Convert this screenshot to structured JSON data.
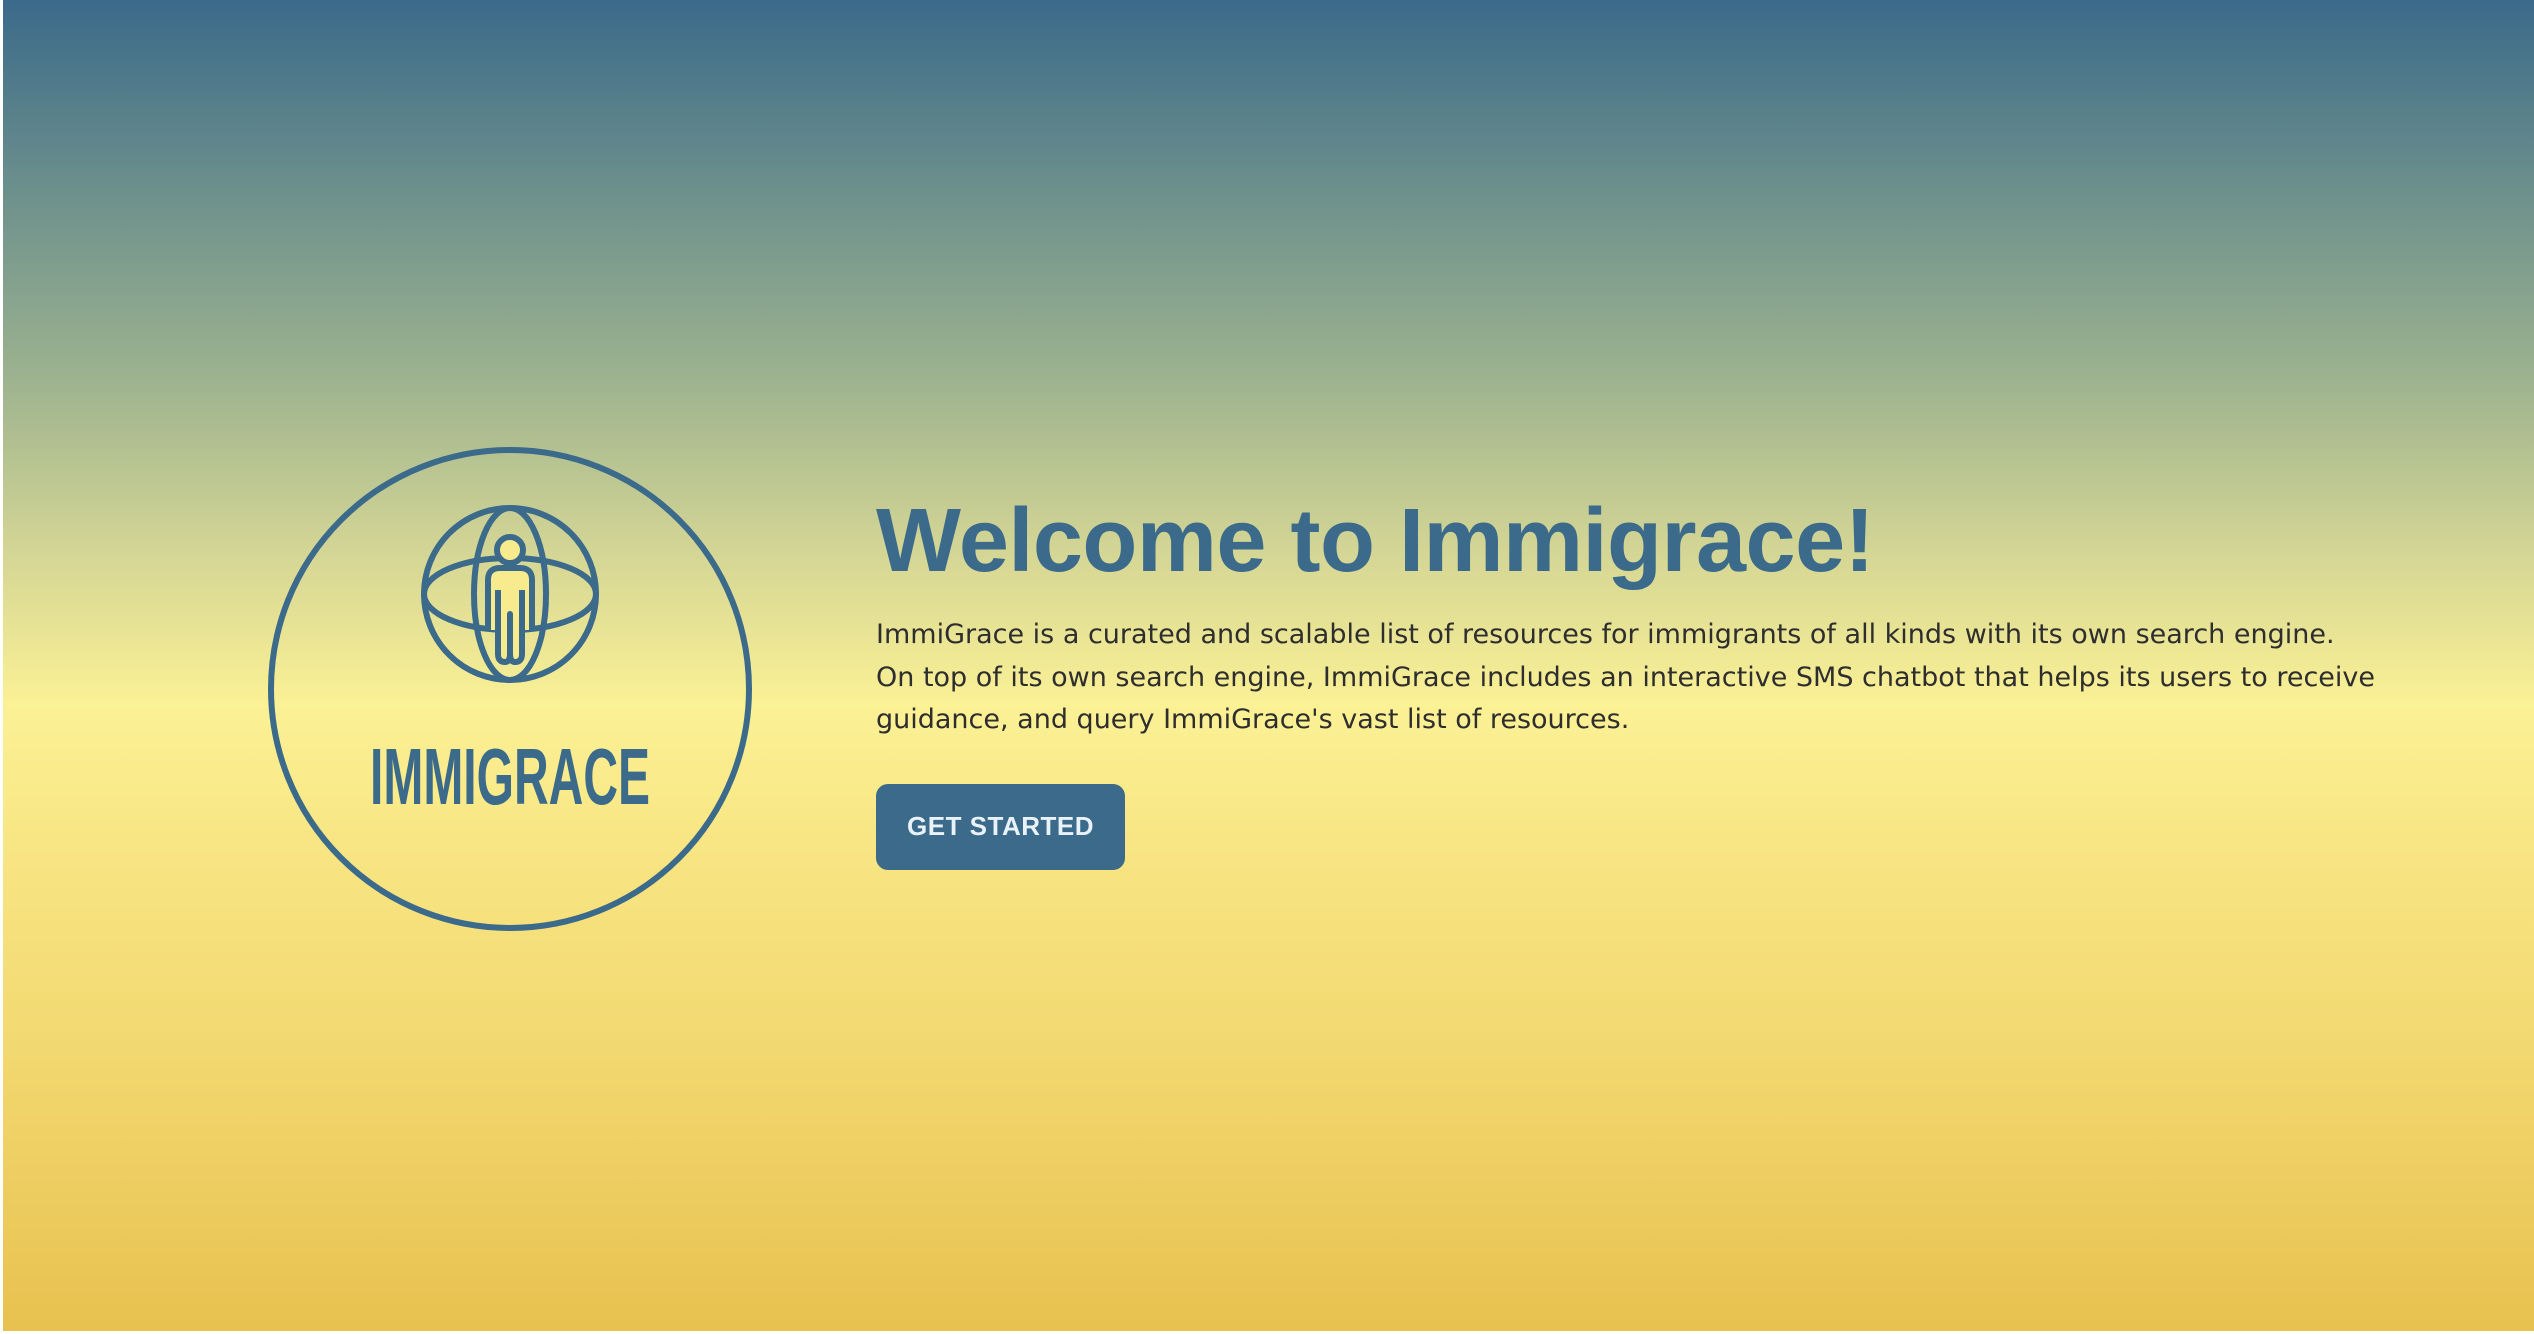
{
  "colors": {
    "brand_blue": "#3b6a8a",
    "text_dark": "#2e2e2e",
    "gradient_top": "#3b6a8a",
    "gradient_mid": "#fbf195",
    "gradient_bottom": "#e8c14f"
  },
  "logo": {
    "wordmark": "IMMIGRACE",
    "icon": "globe-person-icon"
  },
  "hero": {
    "title": "Welcome to Immigrace!",
    "description": "ImmiGrace is a curated and scalable list of resources for immigrants of all kinds with its own search engine. On top of its own search engine, ImmiGrace includes an interactive SMS chatbot that helps its users to receive guidance, and query ImmiGrace's vast list of resources.",
    "cta_label": "GET STARTED"
  }
}
